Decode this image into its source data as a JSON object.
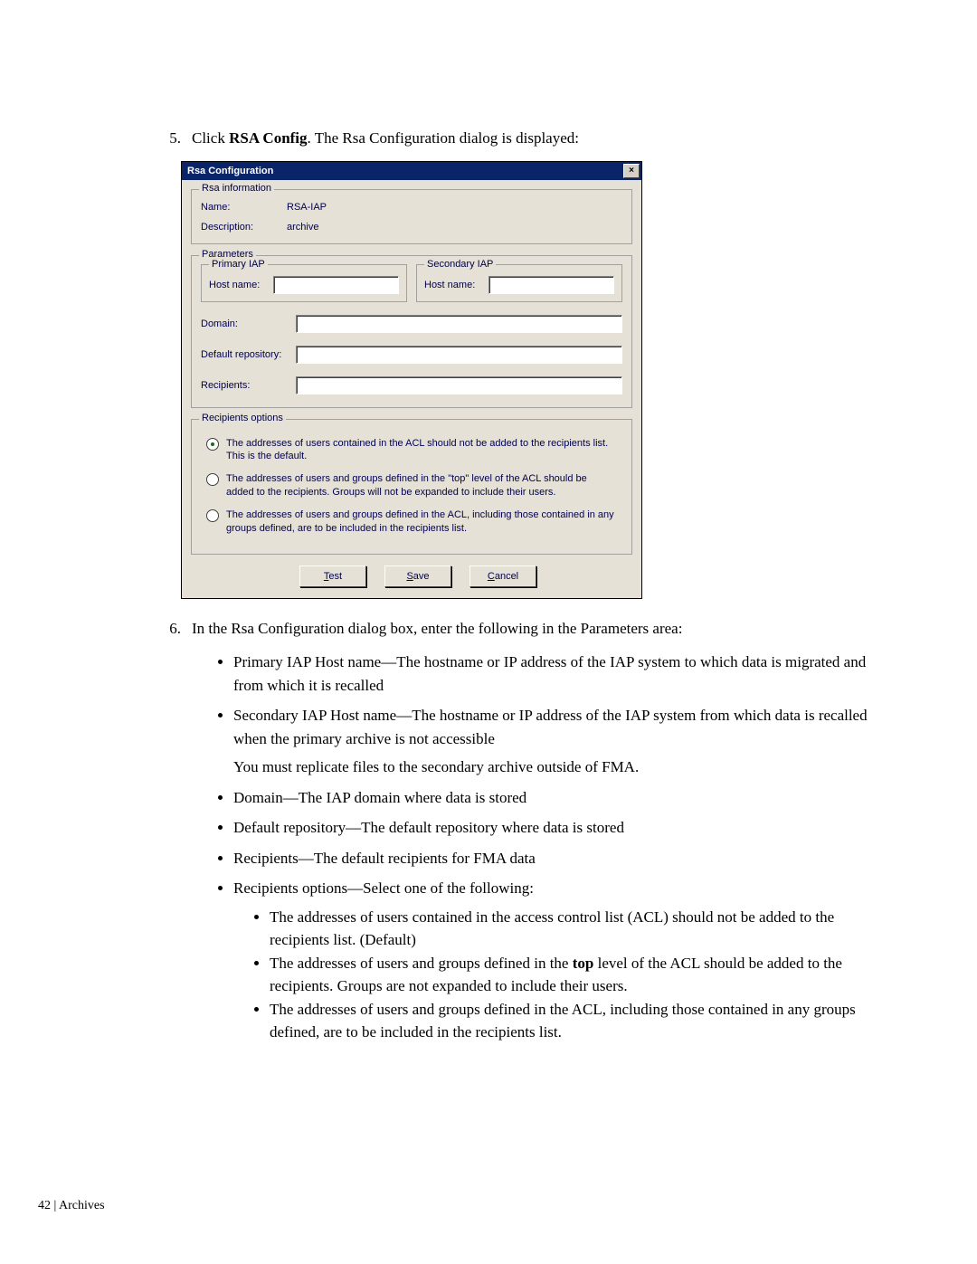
{
  "steps": {
    "s5_num": "5.",
    "s5_prefix": "Click ",
    "s5_bold": "RSA Config",
    "s5_suffix": ". The Rsa Configuration dialog is displayed:",
    "s6_num": "6.",
    "s6_text": "In the Rsa Configuration dialog box, enter the following in the Parameters area:"
  },
  "dialog": {
    "title": "Rsa Configuration",
    "close_glyph": "×",
    "info_legend": "Rsa information",
    "name_label": "Name:",
    "name_value": "RSA-IAP",
    "desc_label": "Description:",
    "desc_value": "archive",
    "params_legend": "Parameters",
    "primary_legend": "Primary IAP",
    "primary_host_label": "Host name:",
    "secondary_legend": "Secondary IAP",
    "secondary_host_label": "Host name:",
    "domain_label": "Domain:",
    "default_repo_label": "Default repository:",
    "recipients_label": "Recipients:",
    "recip_opts_legend": "Recipients options",
    "opt1": "The addresses of users contained in the ACL should not be added to the recipients list. This is the default.",
    "opt2": "The addresses of users and groups defined in the \"top\" level of the ACL should be added to the recipients.  Groups will not be expanded to include their users.",
    "opt3": "The addresses of users and groups defined in the ACL, including those contained in any groups defined, are to be included in the recipients list.",
    "btn_test_u": "T",
    "btn_test_rest": "est",
    "btn_save_u": "S",
    "btn_save_rest": "ave",
    "btn_cancel_u": "C",
    "btn_cancel_rest": "ancel"
  },
  "list": {
    "b1": "Primary IAP Host name—The hostname or IP address of the IAP system to which data is migrated and from which it is recalled",
    "b2": "Secondary IAP Host name—The hostname or IP address of the IAP system from which data is recalled when the primary archive is not accessible",
    "b2_note": "You must replicate files to the secondary archive outside of FMA.",
    "b3": "Domain—The IAP domain where data is stored",
    "b4": "Default repository—The default repository where data is stored",
    "b5": "Recipients—The default recipients for FMA data",
    "b6": "Recipients options—Select one of the following:",
    "s1": "The addresses of users contained in the access control list (ACL) should not be added to the recipients list. (Default)",
    "s2_pre": "The addresses of users and groups defined in the ",
    "s2_bold": "top",
    "s2_post": " level of the ACL should be added to the recipients. Groups are not expanded to include their users.",
    "s3": "The addresses of users and groups defined in the ACL, including those contained in any groups defined, are to be included in the recipients list."
  },
  "footer": "42 | Archives"
}
